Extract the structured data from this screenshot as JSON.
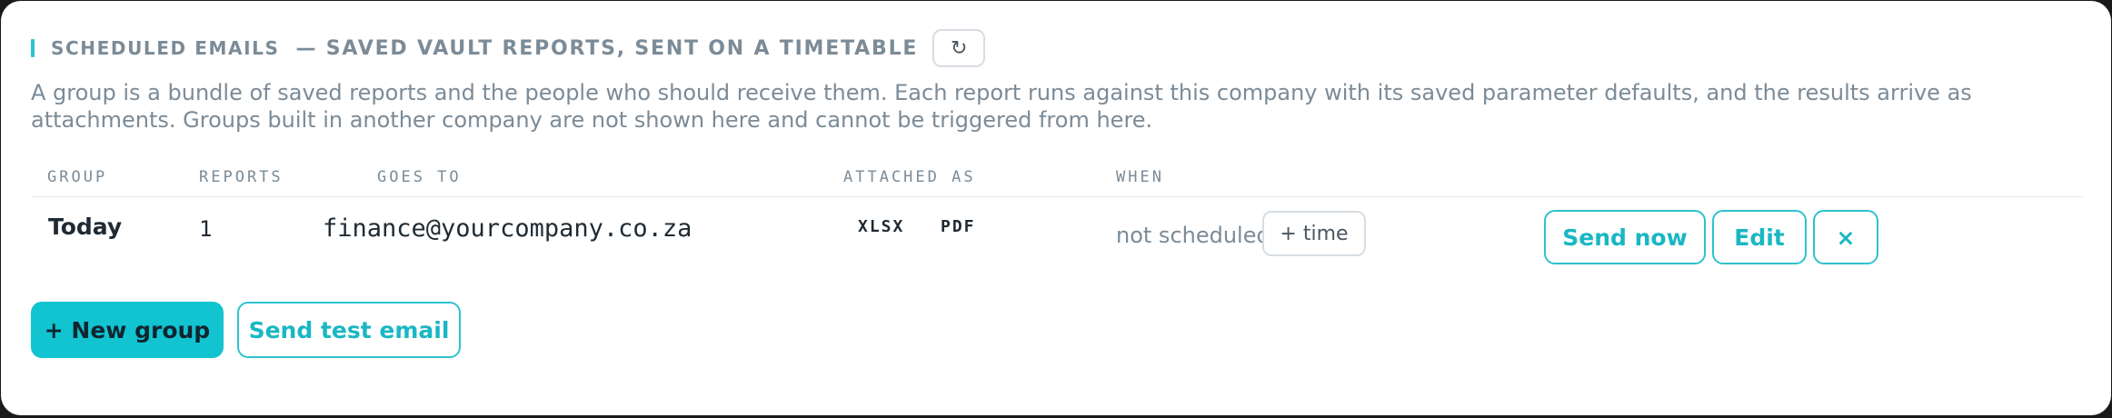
{
  "header": {
    "title": "SCHEDULED EMAILS",
    "subtitle": "— SAVED VAULT REPORTS, SENT ON A TIMETABLE",
    "refresh_icon": "↻"
  },
  "description": "A group is a bundle of saved reports and the people who should receive them. Each report runs against this company with its saved parameter defaults, and the results arrive as attachments. Groups built in another company are not shown here and cannot be triggered from here.",
  "table": {
    "columns": [
      "GROUP",
      "REPORTS",
      "GOES TO",
      "ATTACHED AS",
      "WHEN"
    ],
    "rows": [
      {
        "group": "Today",
        "reports": "1",
        "recipients": "finance@yourcompany.co.za",
        "formats": [
          "XLSX",
          "PDF"
        ],
        "when": "not scheduled",
        "add_time_label": "+ time",
        "send_now_label": "Send now",
        "edit_label": "Edit",
        "delete_label": "×"
      }
    ]
  },
  "footer": {
    "new_group_label": "+ New group",
    "send_test_label": "Send test email"
  },
  "colors": {
    "accent": "#2cc3cf",
    "primary_button": "#12c3d0",
    "muted_text": "#7b8b97",
    "dark_text": "#1f2a33"
  }
}
